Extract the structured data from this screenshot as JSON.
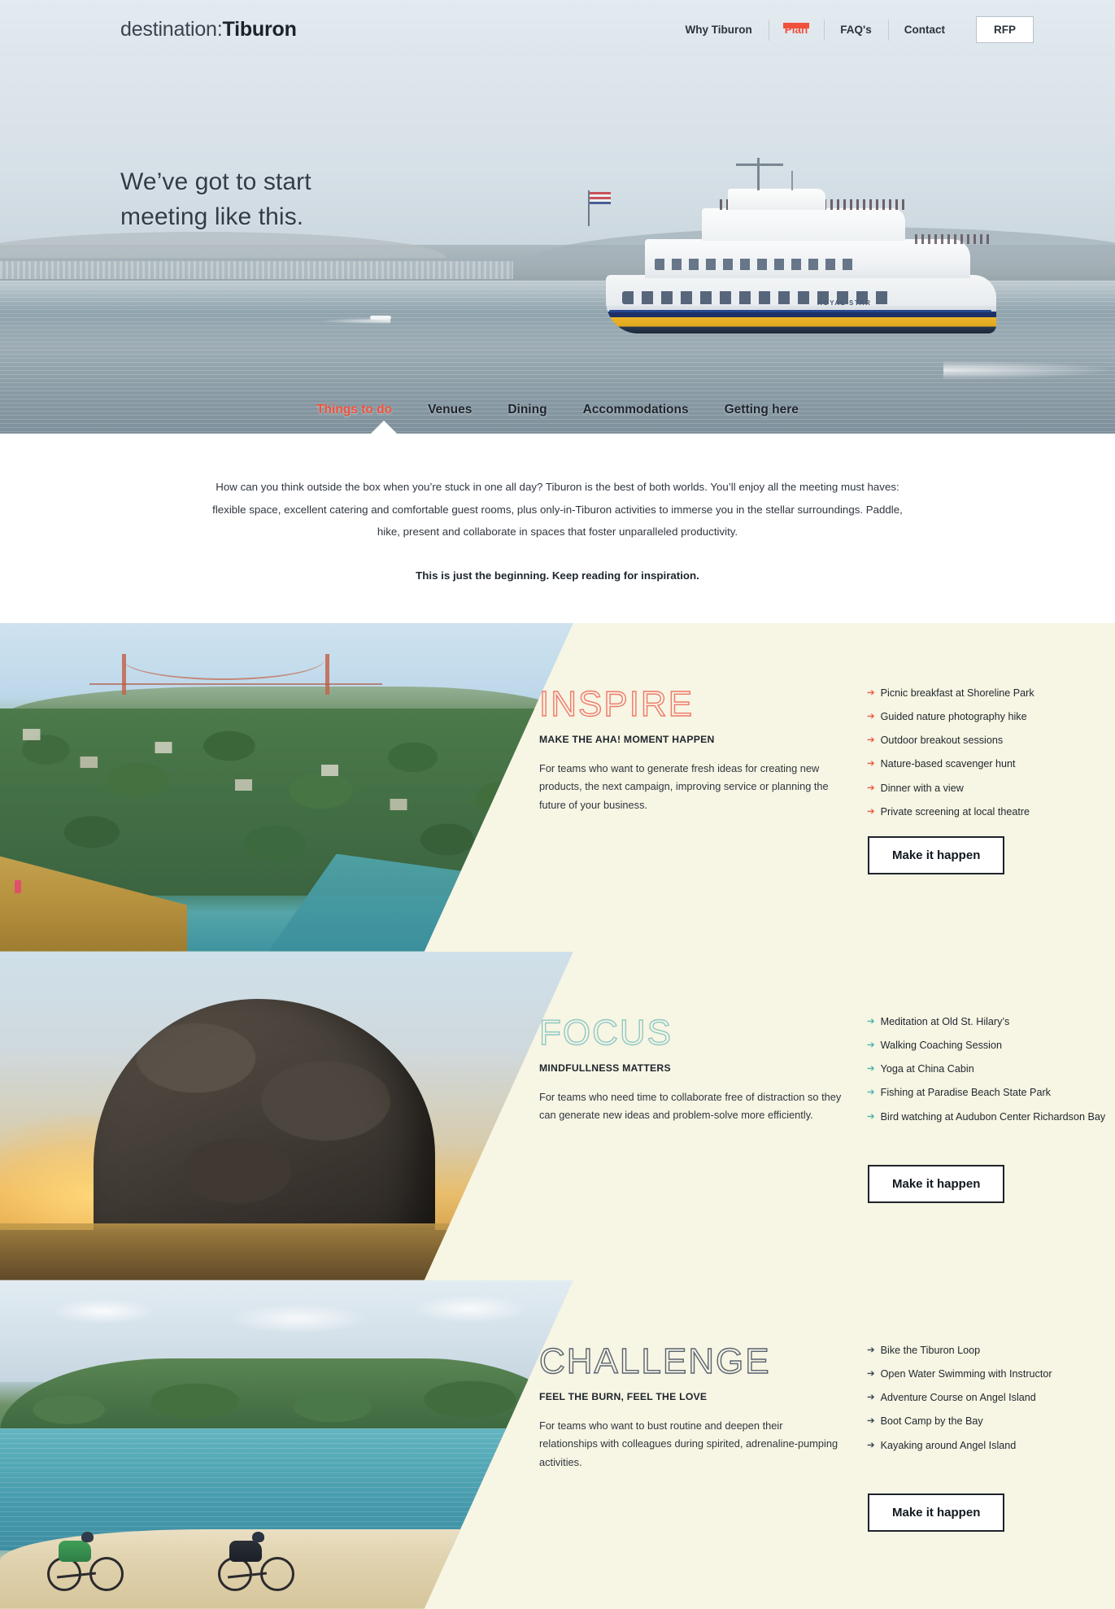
{
  "header": {
    "logo_light": "destination:",
    "logo_bold": "Tiburon",
    "nav": [
      {
        "label": "Why Tiburon",
        "active": false
      },
      {
        "label": "Plan",
        "active": true
      },
      {
        "label": "FAQ's",
        "active": false
      },
      {
        "label": "Contact",
        "active": false
      }
    ],
    "rfp_label": "RFP"
  },
  "hero": {
    "headline_line1": "We’ve got to start",
    "headline_line2": "meeting like this.",
    "boat_name": "ROYAL STAR",
    "subnav": [
      {
        "label": "Things to do",
        "active": true
      },
      {
        "label": "Venues",
        "active": false
      },
      {
        "label": "Dining",
        "active": false
      },
      {
        "label": "Accommodations",
        "active": false
      },
      {
        "label": "Getting here",
        "active": false
      }
    ]
  },
  "intro": {
    "paragraph": "How can you think outside the box when you’re stuck in one all day? Tiburon is the best of both worlds. You’ll enjoy all the meeting must haves: flexible space, excellent catering and comfortable guest rooms, plus only-in-Tiburon activities to immerse you in the stellar surroundings. Paddle, hike, present and collaborate in spaces that foster unparalleled productivity.",
    "kicker": "This is just the beginning. Keep reading for inspiration."
  },
  "sections": [
    {
      "title": "INSPIRE",
      "eyebrow": "MAKE THE AHA! MOMENT HAPPEN",
      "blurb": "For teams who want to generate fresh ideas for creating new products, the next campaign, improving service or planning the future of your business.",
      "accent_color": "#f0786a",
      "bullet_color": "#ef5a43",
      "bullets": [
        "Picnic breakfast at Shoreline Park",
        "Guided nature photography hike",
        "Outdoor breakout sessions",
        "Nature-based scavenger hunt",
        "Dinner with a view",
        "Private screening at local theatre"
      ],
      "cta_label": "Make it happen"
    },
    {
      "title": "FOCUS",
      "eyebrow": "MINDFULLNESS MATTERS",
      "blurb": "For teams who need time to collaborate free of distraction so they can generate new ideas and problem-solve more efficiently.",
      "accent_color": "#8fc9c6",
      "bullet_color": "#4fb3ac",
      "bullets": [
        "Meditation at Old St. Hilary’s",
        "Walking Coaching Session",
        "Yoga at China Cabin",
        "Fishing at Paradise Beach State Park",
        "Bird watching at Audubon Center Richardson Bay"
      ],
      "cta_label": "Make it happen"
    },
    {
      "title": "CHALLENGE",
      "eyebrow": "FEEL THE BURN, FEEL THE LOVE",
      "blurb": "For teams who want to bust routine and deepen their relationships with colleagues during spirited, adrenaline-pumping activities.",
      "accent_color": "#5a6472",
      "bullet_color": "#3a4656",
      "bullets": [
        "Bike the Tiburon Loop",
        "Open Water Swimming with Instructor",
        "Adventure Course on Angel Island",
        "Boot Camp by the Bay",
        "Kayaking around Angel Island"
      ],
      "cta_label": "Make it happen"
    }
  ],
  "icons": {
    "bullet_arrow": "➔"
  }
}
